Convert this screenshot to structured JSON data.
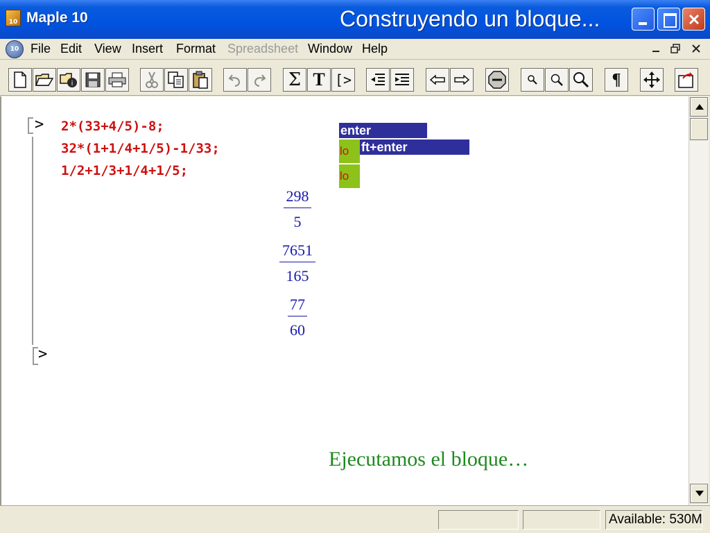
{
  "window": {
    "app_icon_text": "10",
    "app_title": "Maple 10",
    "title": "Construyendo un bloque..."
  },
  "menu": {
    "doc_icon_text": "10",
    "items": [
      {
        "label": "File",
        "enabled": true
      },
      {
        "label": "Edit",
        "enabled": true
      },
      {
        "label": "View",
        "enabled": true
      },
      {
        "label": "Insert",
        "enabled": true
      },
      {
        "label": "Format",
        "enabled": true
      },
      {
        "label": "Spreadsheet",
        "enabled": false
      },
      {
        "label": "Window",
        "enabled": true
      },
      {
        "label": "Help",
        "enabled": true
      }
    ],
    "mdi_controls": [
      "minimize",
      "restore",
      "close"
    ]
  },
  "toolbar": {
    "buttons": [
      "new-document",
      "open-folder",
      "open-url",
      "save",
      "print",
      "cut",
      "copy",
      "paste",
      "undo",
      "redo",
      "sum",
      "text",
      "execution-group",
      "remove-section",
      "insert-section",
      "back",
      "forward",
      "stop",
      "zoom-100",
      "zoom-150",
      "zoom-200",
      "show-paragraph-marks",
      "resize",
      "restart"
    ],
    "sum_symbol": "Σ",
    "text_symbol": "T",
    "group_symbol": "[>",
    "paragraph_symbol": "¶"
  },
  "document": {
    "prompt_symbol": ">",
    "input_lines": [
      "2*(33+4/5)-8;",
      "32*(1+1/4+1/5)-1/33;",
      "1/2+1/3+1/4+1/5;"
    ],
    "outputs": [
      {
        "numerator": "298",
        "denominator": "5"
      },
      {
        "numerator": "7651",
        "denominator": "165"
      },
      {
        "numerator": "77",
        "denominator": "60"
      }
    ],
    "tooltip_lines": [
      "enter",
      "ft+enter"
    ],
    "green_labels": [
      "lo",
      "lo"
    ],
    "caption": "Ejecutamos el bloque…"
  },
  "status": {
    "available": "Available: 530M"
  },
  "colors": {
    "input_code": "#cc1111",
    "output_math": "#1a1aa8",
    "caption": "#1e8a1e",
    "tooltip_bg": "#2f2f9c",
    "green_box": "#8cc21a"
  }
}
